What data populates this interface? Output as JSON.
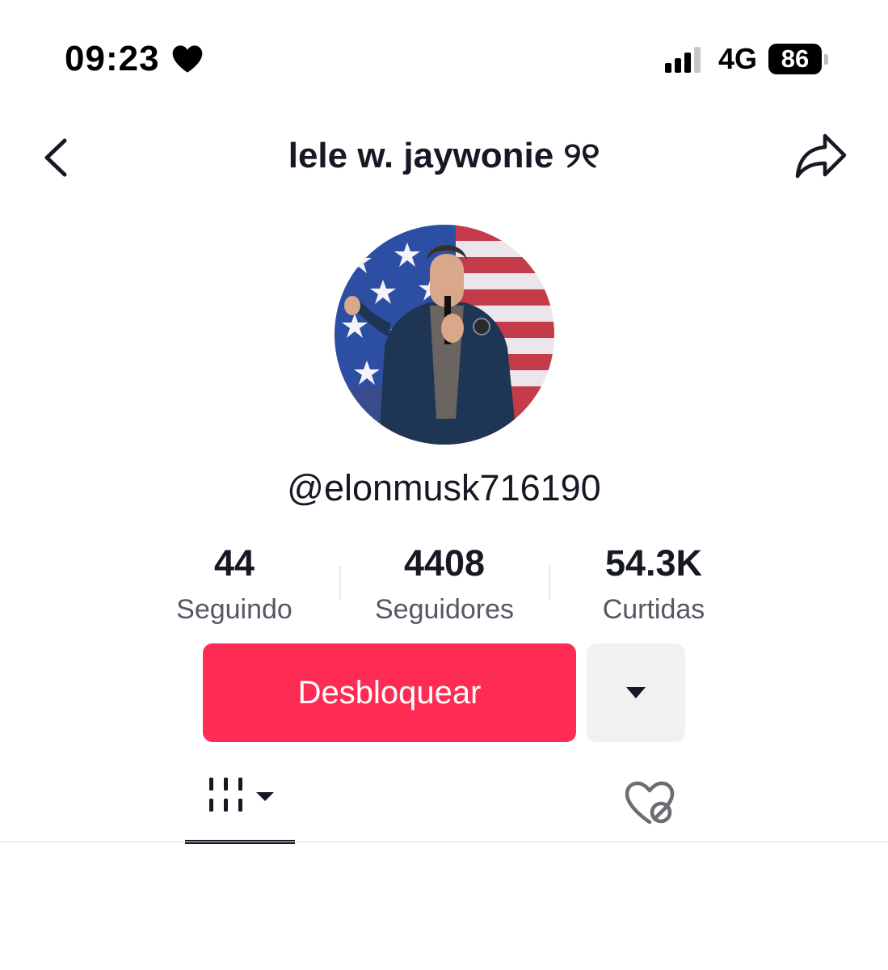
{
  "status_bar": {
    "time": "09:23",
    "network": "4G",
    "battery": "86",
    "signal_bars_active": 3,
    "signal_bars_total": 4
  },
  "header": {
    "title": "lele w. jaywonie ୨୧",
    "back_icon": "chevron-left-icon",
    "share_icon": "share-arrow-icon"
  },
  "profile": {
    "handle": "@elonmusk716190"
  },
  "stats": [
    {
      "value": "44",
      "label": "Seguindo"
    },
    {
      "value": "4408",
      "label": "Seguidores"
    },
    {
      "value": "54.3K",
      "label": "Curtidas"
    }
  ],
  "actions": {
    "unblock_label": "Desbloquear",
    "more_icon": "caret-down-icon"
  },
  "tabs": {
    "videos_icon": "grid-lines-icon",
    "liked_icon": "private-heart-icon",
    "active": "videos"
  },
  "colors": {
    "accent": "#fe2c55",
    "text": "#161823",
    "secondary_text": "#555863",
    "button_gray": "#f1f1f2"
  }
}
